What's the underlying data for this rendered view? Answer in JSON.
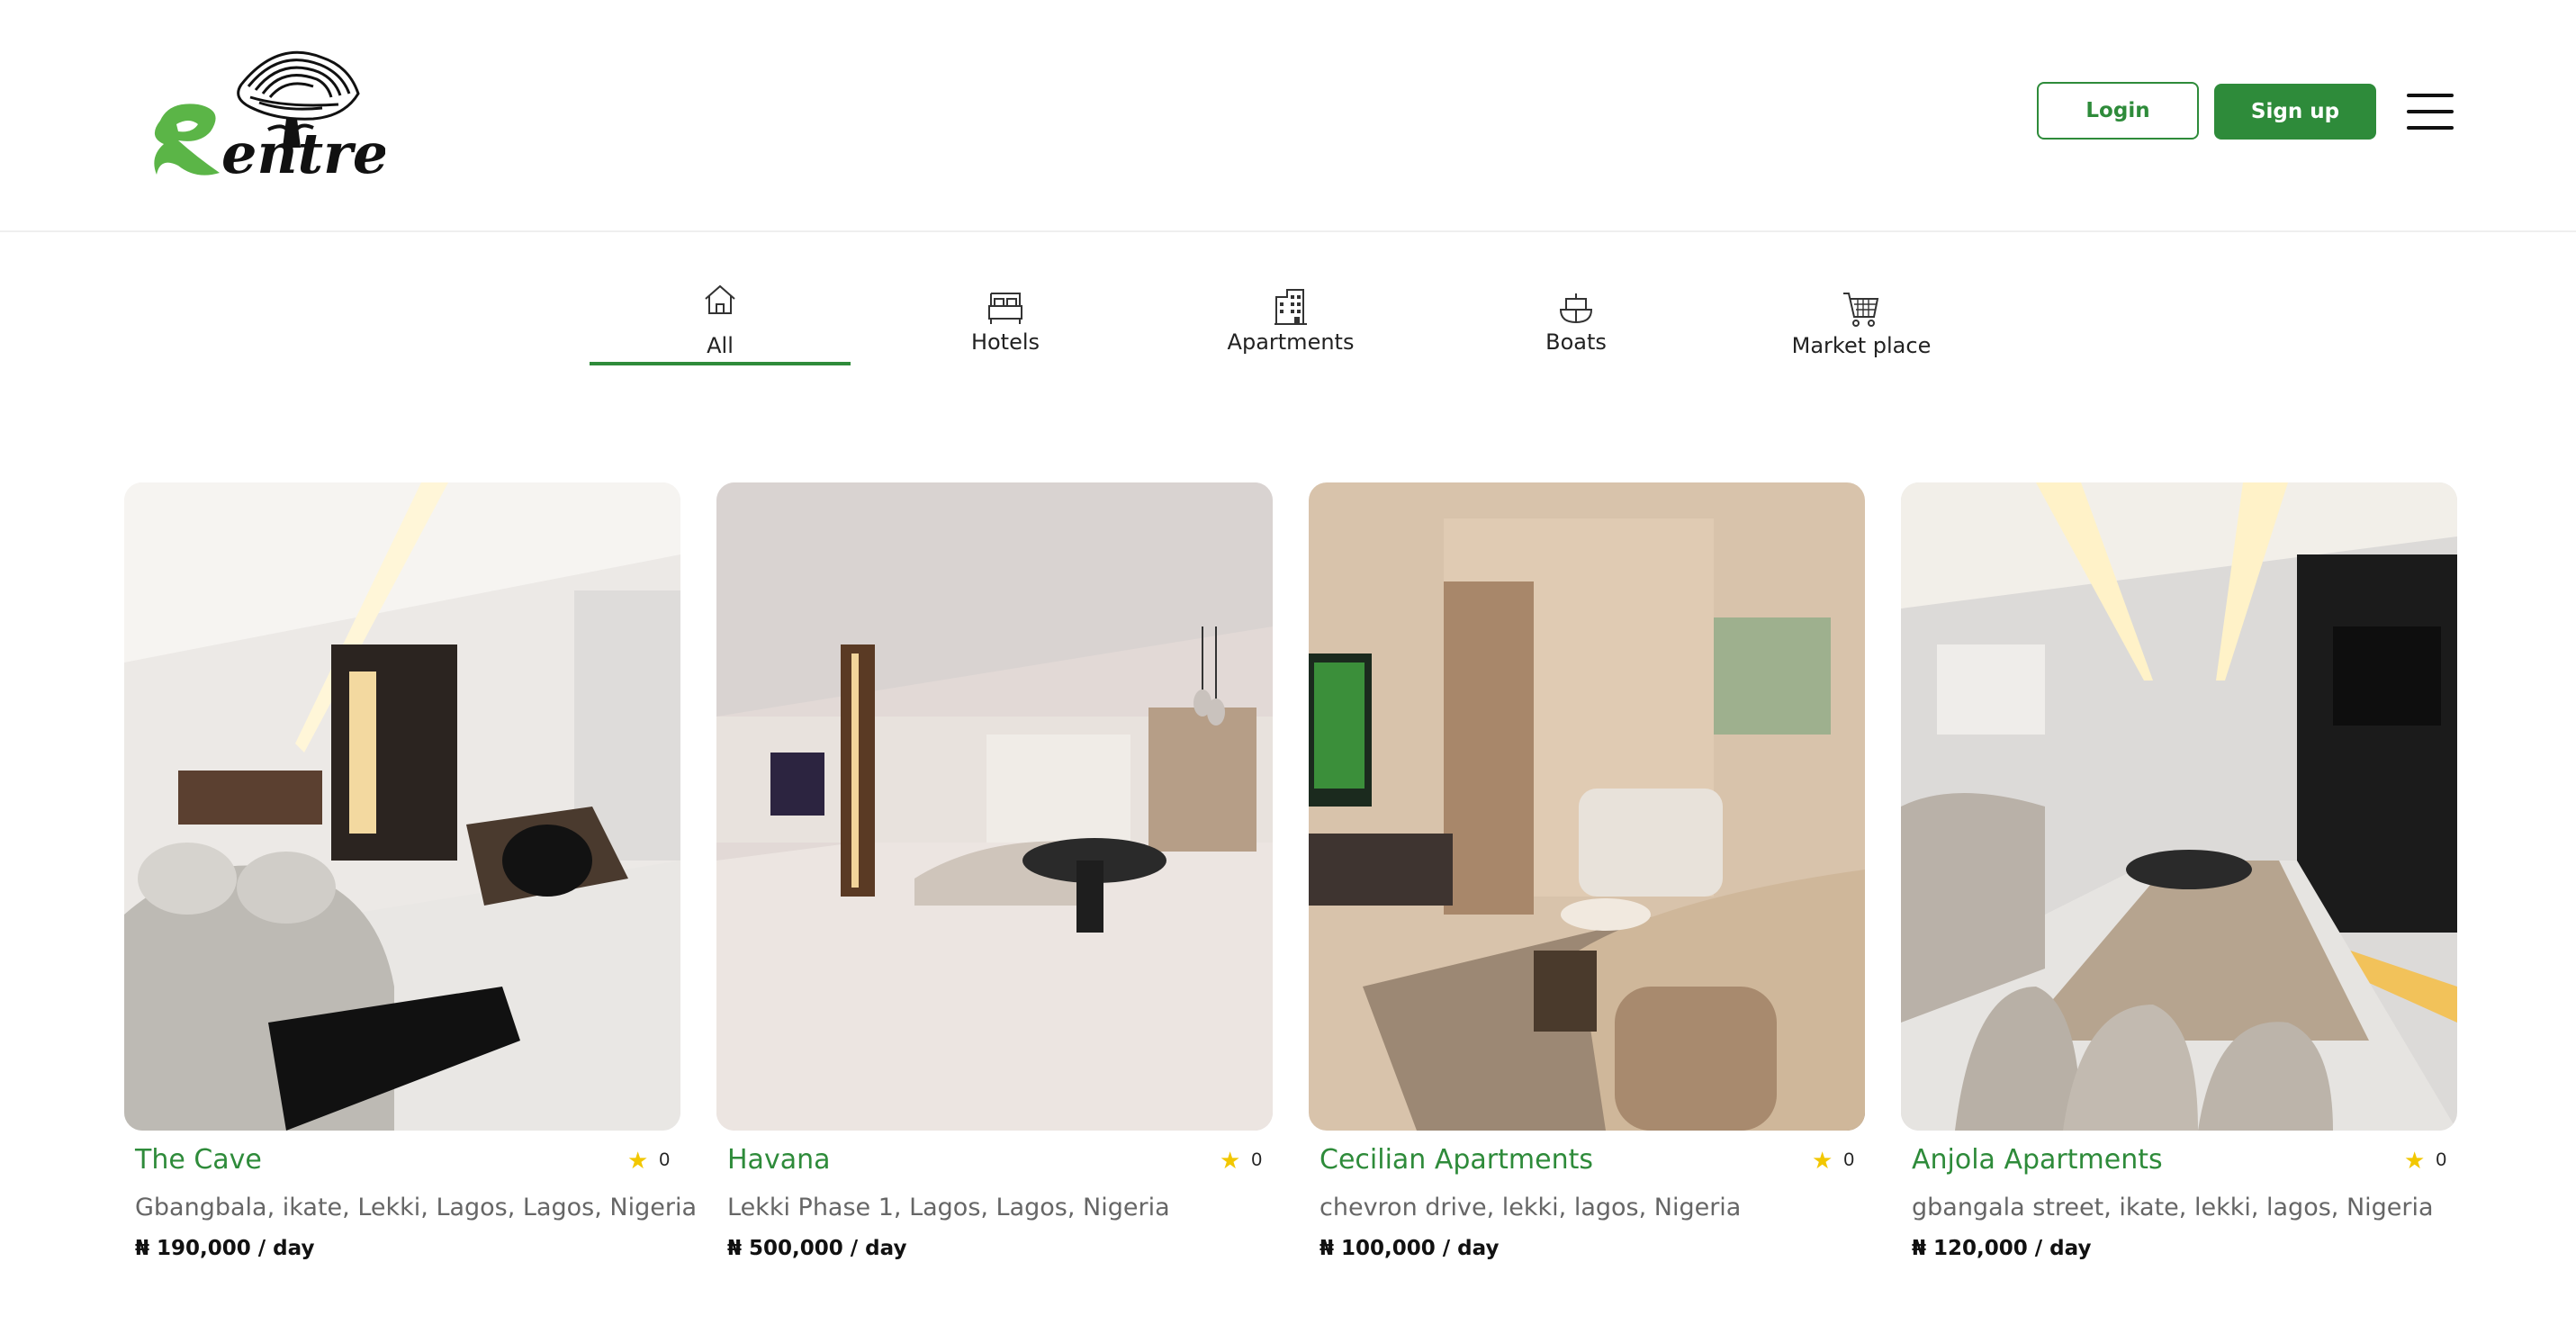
{
  "header": {
    "logo_text": "Rentree",
    "login_label": "Login",
    "signup_label": "Sign up"
  },
  "tabs": [
    {
      "label": "All",
      "icon": "home-icon",
      "active": true
    },
    {
      "label": "Hotels",
      "icon": "bed-icon",
      "active": false
    },
    {
      "label": "Apartments",
      "icon": "building-icon",
      "active": false
    },
    {
      "label": "Boats",
      "icon": "boat-icon",
      "active": false
    },
    {
      "label": "Market place",
      "icon": "cart-icon",
      "active": false
    }
  ],
  "listings": [
    {
      "title": "The Cave",
      "rating": "0",
      "location": "Gbangbala, ikate, Lekki, Lagos, Lagos, Nigeria",
      "price": "₦ 190,000 / day"
    },
    {
      "title": "Havana",
      "rating": "0",
      "location": "Lekki Phase 1, Lagos, Lagos, Nigeria",
      "price": "₦ 500,000 / day"
    },
    {
      "title": "Cecilian Apartments",
      "rating": "0",
      "location": "chevron drive, lekki, lagos, Nigeria",
      "price": "₦ 100,000 / day"
    },
    {
      "title": "Anjola Apartments",
      "rating": "0",
      "location": "gbangala street, ikate, lekki, lagos, Nigeria",
      "price": "₦ 120,000 / day"
    }
  ],
  "colors": {
    "brand_green": "#2e8b3a",
    "star": "#f2c700"
  }
}
